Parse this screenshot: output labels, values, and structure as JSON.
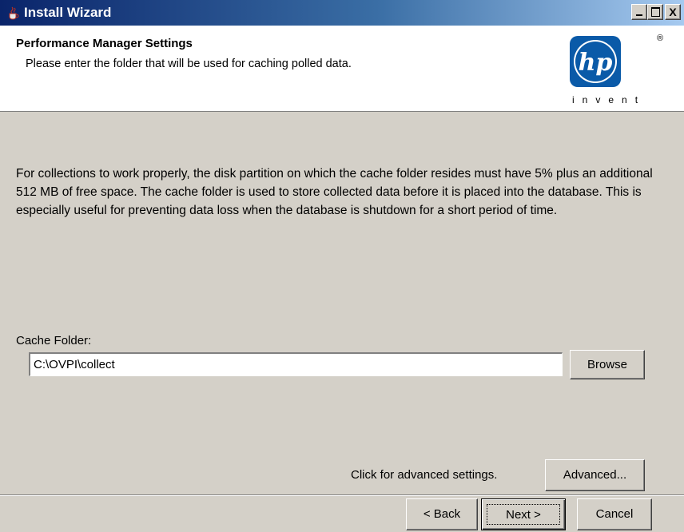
{
  "window": {
    "title": "Install Wizard",
    "controls": {
      "minimize_icon": "minimize-icon",
      "maximize_icon": "maximize-icon",
      "close_icon": "close-icon",
      "close_glyph": "X"
    }
  },
  "header": {
    "title": "Performance Manager Settings",
    "subtitle": "Please enter the folder that will be used for caching polled data.",
    "logo": {
      "text": "hp",
      "registered": "®",
      "tagline": "invent",
      "color": "#0a5aa8"
    }
  },
  "body": {
    "description": "For collections to work properly, the disk partition on which the cache folder resides must have 5% plus an additional 512 MB of free space. The cache folder is used to store collected data before it is placed into the database. This is especially useful for preventing data loss when the database is shutdown for a short period of time.",
    "cache_folder": {
      "label": "Cache Folder:",
      "value": "C:\\OVPI\\collect",
      "browse_label": "Browse"
    },
    "advanced": {
      "note": "Click for advanced settings.",
      "button_label": "Advanced..."
    }
  },
  "footer": {
    "back_label": "< Back",
    "next_label": "Next >",
    "cancel_label": "Cancel"
  },
  "colors": {
    "titlebar_start": "#0a246a",
    "titlebar_end": "#a6caf0",
    "window_bg": "#d4d0c8",
    "header_bg": "#ffffff"
  }
}
